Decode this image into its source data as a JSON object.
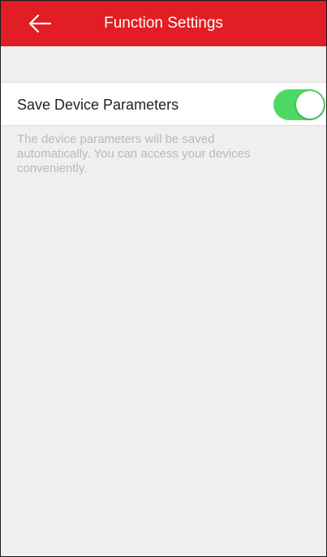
{
  "header": {
    "title": "Function Settings",
    "back_icon": "left-arrow-icon",
    "background_color": "#e21d23"
  },
  "setting": {
    "label": "Save Device Parameters",
    "toggle_on": true,
    "toggle_color": "#4cd964",
    "description": "The device parameters will be saved\nautomatically. You can access your devices\nconveniently."
  }
}
